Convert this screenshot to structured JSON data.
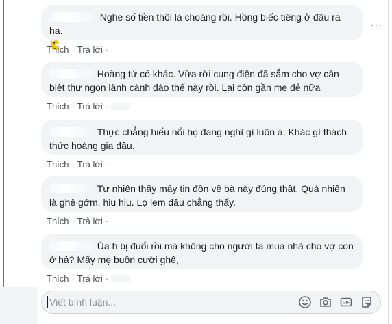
{
  "comments": [
    {
      "text": "Nghe số tiền thôi là choáng rồi. Hồng biếc tiêng ở đâu ra ha.",
      "emoji_icon": "pacman-emoji-icon",
      "like_label": "Thích",
      "reply_label": "Trả lời"
    },
    {
      "text": "Hoàng tử có khác. Vừa rời cung điện đã sắm cho vợ căn biệt thự ngon lành cành đào thế này rồi. Lại còn gần mẹ đẻ nữa",
      "like_label": "Thích",
      "reply_label": "Trả lời"
    },
    {
      "text": "Thực chẳng hiểu nổi họ đang nghĩ gì luôn á. Khác gì thách thức hoàng gia đâu.",
      "like_label": "Thích",
      "reply_label": "Trả lời"
    },
    {
      "text": "Tự nhiên thấy mấy tin đồn về bà này đúng thật. Quả nhiên là ghê gớm. hiu hiu. Lọ lem đâu chẳng thấy.",
      "like_label": "Thích",
      "reply_label": "Trả lời"
    },
    {
      "text": "Ủa h bị đuổi rồi mà không cho người ta mua nhà cho vợ con ở hả? Mấy mẹ buồn cười ghê,",
      "like_label": "Thích",
      "reply_label": "Trả lời"
    }
  ],
  "more_options": "···",
  "composer": {
    "placeholder": "Viết bình luận...",
    "tools": [
      "emoji-icon",
      "camera-icon",
      "gif-icon",
      "sticker-icon"
    ]
  },
  "colors": {
    "bubble": "#f2f3f5",
    "accent_rule": "#4f78b8",
    "action_text": "#4b4f56",
    "placeholder": "#90949c"
  }
}
